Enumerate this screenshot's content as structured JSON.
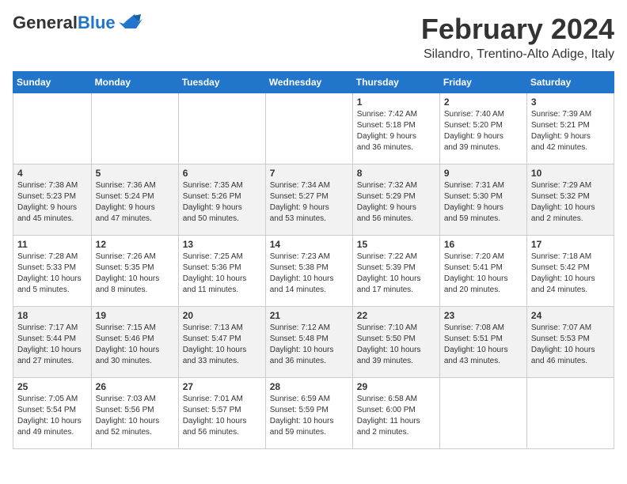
{
  "header": {
    "logo_general": "General",
    "logo_blue": "Blue",
    "month_title": "February 2024",
    "location": "Silandro, Trentino-Alto Adige, Italy"
  },
  "days_of_week": [
    "Sunday",
    "Monday",
    "Tuesday",
    "Wednesday",
    "Thursday",
    "Friday",
    "Saturday"
  ],
  "weeks": [
    [
      {
        "num": "",
        "info": ""
      },
      {
        "num": "",
        "info": ""
      },
      {
        "num": "",
        "info": ""
      },
      {
        "num": "",
        "info": ""
      },
      {
        "num": "1",
        "info": "Sunrise: 7:42 AM\nSunset: 5:18 PM\nDaylight: 9 hours\nand 36 minutes."
      },
      {
        "num": "2",
        "info": "Sunrise: 7:40 AM\nSunset: 5:20 PM\nDaylight: 9 hours\nand 39 minutes."
      },
      {
        "num": "3",
        "info": "Sunrise: 7:39 AM\nSunset: 5:21 PM\nDaylight: 9 hours\nand 42 minutes."
      }
    ],
    [
      {
        "num": "4",
        "info": "Sunrise: 7:38 AM\nSunset: 5:23 PM\nDaylight: 9 hours\nand 45 minutes."
      },
      {
        "num": "5",
        "info": "Sunrise: 7:36 AM\nSunset: 5:24 PM\nDaylight: 9 hours\nand 47 minutes."
      },
      {
        "num": "6",
        "info": "Sunrise: 7:35 AM\nSunset: 5:26 PM\nDaylight: 9 hours\nand 50 minutes."
      },
      {
        "num": "7",
        "info": "Sunrise: 7:34 AM\nSunset: 5:27 PM\nDaylight: 9 hours\nand 53 minutes."
      },
      {
        "num": "8",
        "info": "Sunrise: 7:32 AM\nSunset: 5:29 PM\nDaylight: 9 hours\nand 56 minutes."
      },
      {
        "num": "9",
        "info": "Sunrise: 7:31 AM\nSunset: 5:30 PM\nDaylight: 9 hours\nand 59 minutes."
      },
      {
        "num": "10",
        "info": "Sunrise: 7:29 AM\nSunset: 5:32 PM\nDaylight: 10 hours\nand 2 minutes."
      }
    ],
    [
      {
        "num": "11",
        "info": "Sunrise: 7:28 AM\nSunset: 5:33 PM\nDaylight: 10 hours\nand 5 minutes."
      },
      {
        "num": "12",
        "info": "Sunrise: 7:26 AM\nSunset: 5:35 PM\nDaylight: 10 hours\nand 8 minutes."
      },
      {
        "num": "13",
        "info": "Sunrise: 7:25 AM\nSunset: 5:36 PM\nDaylight: 10 hours\nand 11 minutes."
      },
      {
        "num": "14",
        "info": "Sunrise: 7:23 AM\nSunset: 5:38 PM\nDaylight: 10 hours\nand 14 minutes."
      },
      {
        "num": "15",
        "info": "Sunrise: 7:22 AM\nSunset: 5:39 PM\nDaylight: 10 hours\nand 17 minutes."
      },
      {
        "num": "16",
        "info": "Sunrise: 7:20 AM\nSunset: 5:41 PM\nDaylight: 10 hours\nand 20 minutes."
      },
      {
        "num": "17",
        "info": "Sunrise: 7:18 AM\nSunset: 5:42 PM\nDaylight: 10 hours\nand 24 minutes."
      }
    ],
    [
      {
        "num": "18",
        "info": "Sunrise: 7:17 AM\nSunset: 5:44 PM\nDaylight: 10 hours\nand 27 minutes."
      },
      {
        "num": "19",
        "info": "Sunrise: 7:15 AM\nSunset: 5:46 PM\nDaylight: 10 hours\nand 30 minutes."
      },
      {
        "num": "20",
        "info": "Sunrise: 7:13 AM\nSunset: 5:47 PM\nDaylight: 10 hours\nand 33 minutes."
      },
      {
        "num": "21",
        "info": "Sunrise: 7:12 AM\nSunset: 5:48 PM\nDaylight: 10 hours\nand 36 minutes."
      },
      {
        "num": "22",
        "info": "Sunrise: 7:10 AM\nSunset: 5:50 PM\nDaylight: 10 hours\nand 39 minutes."
      },
      {
        "num": "23",
        "info": "Sunrise: 7:08 AM\nSunset: 5:51 PM\nDaylight: 10 hours\nand 43 minutes."
      },
      {
        "num": "24",
        "info": "Sunrise: 7:07 AM\nSunset: 5:53 PM\nDaylight: 10 hours\nand 46 minutes."
      }
    ],
    [
      {
        "num": "25",
        "info": "Sunrise: 7:05 AM\nSunset: 5:54 PM\nDaylight: 10 hours\nand 49 minutes."
      },
      {
        "num": "26",
        "info": "Sunrise: 7:03 AM\nSunset: 5:56 PM\nDaylight: 10 hours\nand 52 minutes."
      },
      {
        "num": "27",
        "info": "Sunrise: 7:01 AM\nSunset: 5:57 PM\nDaylight: 10 hours\nand 56 minutes."
      },
      {
        "num": "28",
        "info": "Sunrise: 6:59 AM\nSunset: 5:59 PM\nDaylight: 10 hours\nand 59 minutes."
      },
      {
        "num": "29",
        "info": "Sunrise: 6:58 AM\nSunset: 6:00 PM\nDaylight: 11 hours\nand 2 minutes."
      },
      {
        "num": "",
        "info": ""
      },
      {
        "num": "",
        "info": ""
      }
    ]
  ]
}
